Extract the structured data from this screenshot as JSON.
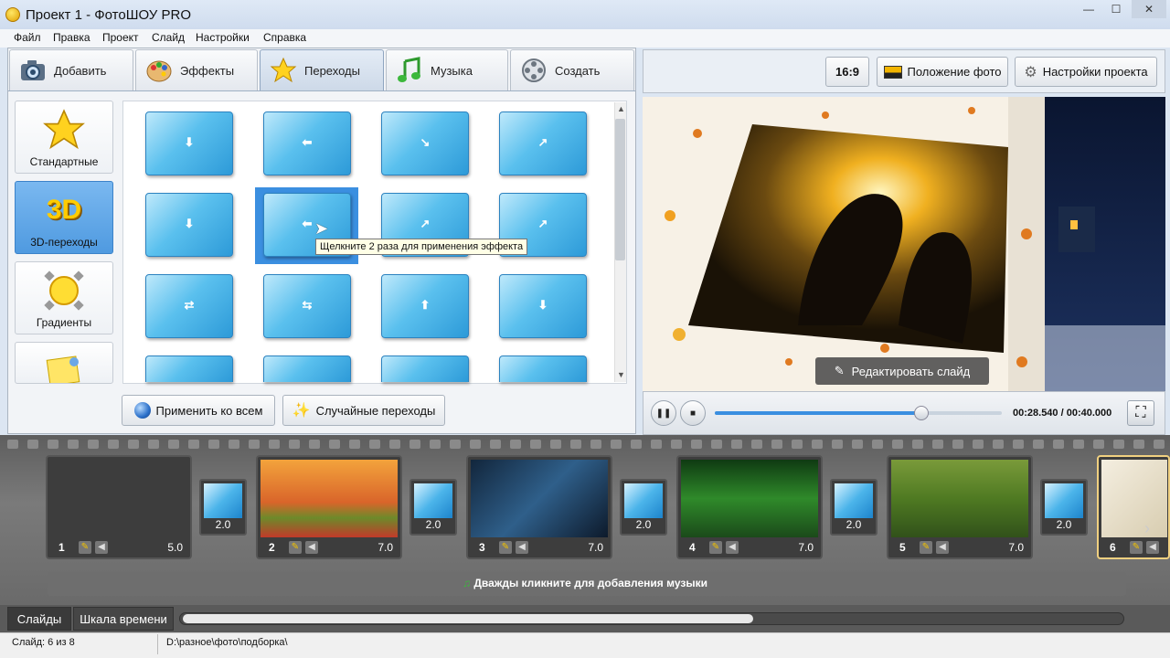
{
  "window": {
    "title": "Проект 1 - ФотоШОУ PRO",
    "minimize": "—",
    "maximize": "☐",
    "close": "✕"
  },
  "menu": [
    "Файл",
    "Правка",
    "Проект",
    "Слайд",
    "Настройки",
    "Справка"
  ],
  "tabs": [
    {
      "label": "Добавить",
      "icon": "camera-icon"
    },
    {
      "label": "Эффекты",
      "icon": "palette-icon"
    },
    {
      "label": "Переходы",
      "icon": "star-icon",
      "active": true
    },
    {
      "label": "Музыка",
      "icon": "music-note-icon"
    },
    {
      "label": "Создать",
      "icon": "film-reel-icon"
    }
  ],
  "categories": [
    {
      "label": "Стандартные",
      "icon": "star-icon"
    },
    {
      "label": "3D-переходы",
      "icon": "3d-icon",
      "icon_text": "3D",
      "active": true
    },
    {
      "label": "Градиенты",
      "icon": "gradient-sun-icon"
    },
    {
      "label": "",
      "icon": "sticky-note-icon"
    }
  ],
  "transitions": {
    "arrows": [
      "⬇",
      "⬅",
      "↘",
      "↗",
      "⬇",
      "⬅",
      "↗",
      "↗",
      "⇄",
      "⇆",
      "⬆",
      "⬇",
      "",
      "",
      "",
      ""
    ],
    "tooltip": "Щелкните 2 раза для применения эффекта"
  },
  "actions": {
    "apply_all": "Применить ко всем",
    "random": "Случайные переходы"
  },
  "preview_toolbar": {
    "aspect": "16:9",
    "photo_position": "Положение фото",
    "project_settings": "Настройки проекта"
  },
  "preview": {
    "edit_slide": "Редактировать слайд"
  },
  "player": {
    "time": "00:28.540 / 00:40.000",
    "progress": 0.72
  },
  "slides": [
    {
      "num": "1",
      "duration": "5.0"
    },
    {
      "num": "2",
      "duration": "7.0"
    },
    {
      "num": "3",
      "duration": "7.0"
    },
    {
      "num": "4",
      "duration": "7.0"
    },
    {
      "num": "5",
      "duration": "7.0"
    },
    {
      "num": "6",
      "duration": ""
    }
  ],
  "transitions_strip": [
    "2.0",
    "2.0",
    "2.0",
    "2.0",
    "2.0"
  ],
  "music_hint": "Дважды кликните для добавления музыки",
  "bottom_tabs": {
    "slides": "Слайды",
    "timeline": "Шкала времени"
  },
  "status": {
    "slide": "Слайд: 6 из 8",
    "path": "D:\\разное\\фото\\подборка\\"
  }
}
